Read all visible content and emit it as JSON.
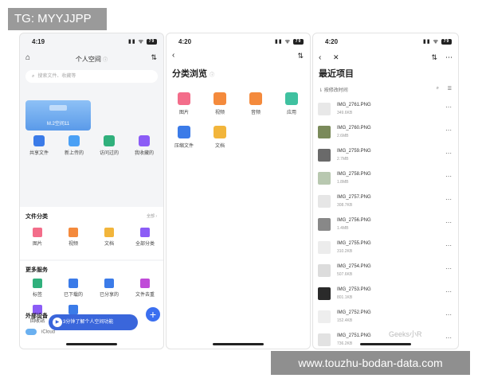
{
  "watermark_top": "TG: MYYJJPP",
  "watermark_bottom": "www.touzhu-bodan-data.com",
  "watermark_mid": "Geeks小R",
  "colors": {
    "accent": "#3b6ff0",
    "banner": "#3a66db"
  },
  "phone1": {
    "time": "4:19",
    "battery": "79",
    "title": "个人空间",
    "search_placeholder": "搜索文件、收藏等",
    "card_text": "M.2空间11",
    "quick": [
      {
        "label": "共享文件",
        "icon": "folder-icon",
        "color": "#3b7be8"
      },
      {
        "label": "新上传的",
        "icon": "cloud-upload-icon",
        "color": "#4aa0f5"
      },
      {
        "label": "访问过的",
        "icon": "clock-icon",
        "color": "#30b07c"
      },
      {
        "label": "我收藏的",
        "icon": "star-icon",
        "color": "#8b5cf6"
      }
    ],
    "file_section": {
      "title": "文件分类",
      "more": "全部 ›",
      "items": [
        {
          "label": "图片",
          "icon": "image-icon",
          "color": "#f36d8a"
        },
        {
          "label": "视频",
          "icon": "video-icon",
          "color": "#f48a3c"
        },
        {
          "label": "文档",
          "icon": "document-icon",
          "color": "#f2b53b"
        },
        {
          "label": "全部分类",
          "icon": "grid-icon",
          "color": "#8b5cf6"
        }
      ]
    },
    "more_section": {
      "title": "更多服务",
      "items": [
        {
          "label": "标签",
          "icon": "tag-icon",
          "color": "#30b07c"
        },
        {
          "label": "已下载的",
          "icon": "download-icon",
          "color": "#3b7be8"
        },
        {
          "label": "已分享的",
          "icon": "share-icon",
          "color": "#3b7be8"
        },
        {
          "label": "文件去重",
          "icon": "dedupe-icon",
          "color": "#c04bd8"
        },
        {
          "label": "回收站",
          "icon": "trash-icon",
          "color": "#8b5cf6"
        },
        {
          "label": "设置",
          "icon": "settings-icon",
          "color": "#3b7be8"
        }
      ]
    },
    "ext_title": "外部设备",
    "icloud_label": "iCloud",
    "banner_text": "3分钟了解个人空间功能"
  },
  "phone2": {
    "time": "4:20",
    "battery": "79",
    "title": "分类浏览",
    "categories": [
      {
        "label": "图片",
        "icon": "image-icon",
        "color": "#f36d8a"
      },
      {
        "label": "视频",
        "icon": "video-icon",
        "color": "#f48a3c"
      },
      {
        "label": "音频",
        "icon": "music-icon",
        "color": "#f48a3c"
      },
      {
        "label": "应用",
        "icon": "app-icon",
        "color": "#3fc1a0"
      },
      {
        "label": "压缩文件",
        "icon": "zip-icon",
        "color": "#3b7be8"
      },
      {
        "label": "文档",
        "icon": "document-icon",
        "color": "#f2b53b"
      }
    ]
  },
  "phone3": {
    "time": "4:20",
    "battery": "79",
    "title": "最近项目",
    "filter": "按修改时间",
    "files": [
      {
        "name": "IMG_2761.PNG",
        "size": "349.6KB",
        "thumb": "#e8e8e8"
      },
      {
        "name": "IMG_2760.PNG",
        "size": "2.6MB",
        "thumb": "#7a8a5a"
      },
      {
        "name": "IMG_2759.PNG",
        "size": "2.7MB",
        "thumb": "#6a6a6a"
      },
      {
        "name": "IMG_2758.PNG",
        "size": "1.8MB",
        "thumb": "#b8c8b0"
      },
      {
        "name": "IMG_2757.PNG",
        "size": "308.7KB",
        "thumb": "#e6e6e6"
      },
      {
        "name": "IMG_2756.PNG",
        "size": "1.4MB",
        "thumb": "#888888"
      },
      {
        "name": "IMG_2755.PNG",
        "size": "310.2KB",
        "thumb": "#ececec"
      },
      {
        "name": "IMG_2754.PNG",
        "size": "507.6KB",
        "thumb": "#dcdcdc"
      },
      {
        "name": "IMG_2753.PNG",
        "size": "801.1KB",
        "thumb": "#2a2a2a"
      },
      {
        "name": "IMG_2752.PNG",
        "size": "152.4KB",
        "thumb": "#eeeeee"
      },
      {
        "name": "IMG_2751.PNG",
        "size": "736.2KB",
        "thumb": "#e2e2e2"
      }
    ]
  }
}
